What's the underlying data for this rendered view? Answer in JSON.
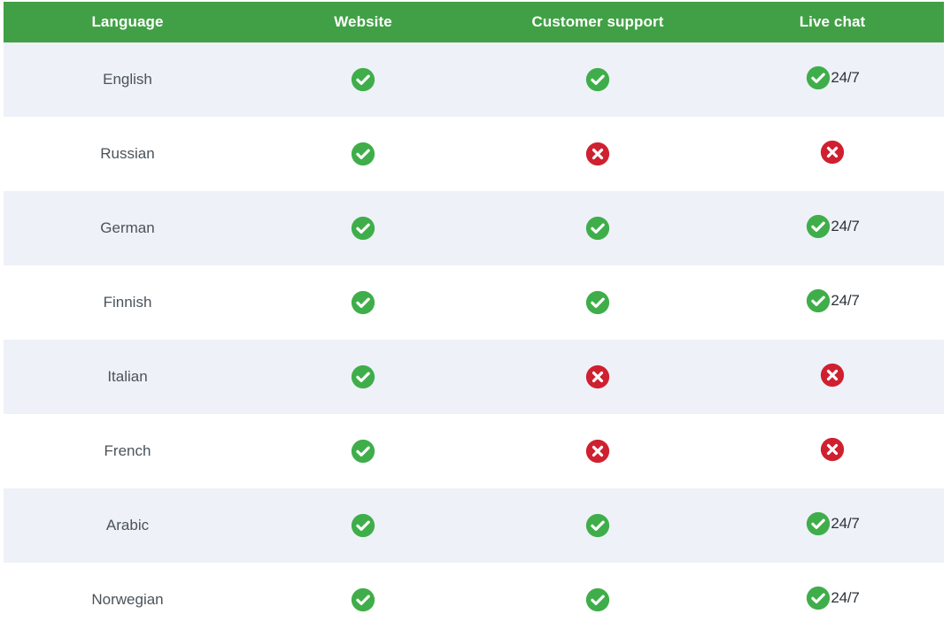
{
  "table": {
    "headers": [
      {
        "label": "Language"
      },
      {
        "label": "Website"
      },
      {
        "label": "Customer support"
      },
      {
        "label": "Live chat"
      }
    ],
    "colors": {
      "header_bg": "#41a045",
      "stripe_bg": "#eef1f7",
      "row_bg": "#ffffff",
      "check_green": "#3fae4a",
      "cross_red": "#cf2030",
      "language_text": "#4b535a",
      "label_text": "#2d3338"
    },
    "icons": {
      "check": "check-circle-icon",
      "cross": "cross-circle-icon"
    },
    "rows": [
      {
        "language": "English",
        "website": {
          "status": "yes"
        },
        "customer_support": {
          "status": "yes"
        },
        "live_chat": {
          "status": "yes",
          "label": "24/7"
        }
      },
      {
        "language": "Russian",
        "website": {
          "status": "yes"
        },
        "customer_support": {
          "status": "no"
        },
        "live_chat": {
          "status": "no",
          "label": ""
        }
      },
      {
        "language": "German",
        "website": {
          "status": "yes"
        },
        "customer_support": {
          "status": "yes"
        },
        "live_chat": {
          "status": "yes",
          "label": "24/7"
        }
      },
      {
        "language": "Finnish",
        "website": {
          "status": "yes"
        },
        "customer_support": {
          "status": "yes"
        },
        "live_chat": {
          "status": "yes",
          "label": "24/7"
        }
      },
      {
        "language": "Italian",
        "website": {
          "status": "yes"
        },
        "customer_support": {
          "status": "no"
        },
        "live_chat": {
          "status": "no",
          "label": ""
        }
      },
      {
        "language": "French",
        "website": {
          "status": "yes"
        },
        "customer_support": {
          "status": "no"
        },
        "live_chat": {
          "status": "no",
          "label": ""
        }
      },
      {
        "language": "Arabic",
        "website": {
          "status": "yes"
        },
        "customer_support": {
          "status": "yes"
        },
        "live_chat": {
          "status": "yes",
          "label": "24/7"
        }
      },
      {
        "language": "Norwegian",
        "website": {
          "status": "yes"
        },
        "customer_support": {
          "status": "yes"
        },
        "live_chat": {
          "status": "yes",
          "label": "24/7"
        }
      }
    ]
  }
}
